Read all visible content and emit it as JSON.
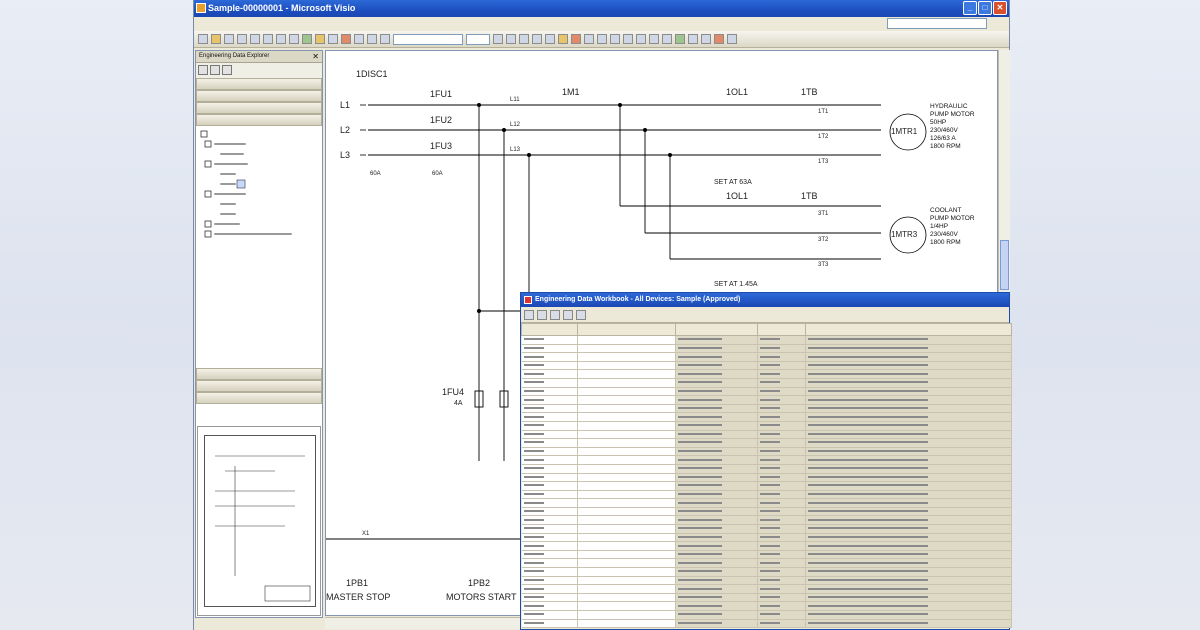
{
  "titlebar": {
    "title": "Sample-00000001 - Microsoft Visio"
  },
  "menu": [],
  "explorer": {
    "title": "Engineering Data Explorer",
    "nav_top": [
      "",
      "",
      "",
      ""
    ],
    "nav_bottom": [
      "",
      "",
      ""
    ]
  },
  "schematic": {
    "disconnect": "1DISC1",
    "lines": [
      "L1",
      "L2",
      "L3"
    ],
    "fuse_labels": [
      "1FU1",
      "1FU2",
      "1FU3"
    ],
    "wires": [
      "L11",
      "L12",
      "L13"
    ],
    "contactor": "1M1",
    "overload_1": "1OL1",
    "overload_2": "1OL1",
    "tb_1": "1TB",
    "tb_2": "1TB",
    "motor_1": "1MTR1",
    "motor_2": "1MTR3",
    "terminals_1": [
      "1T1",
      "1T2",
      "1T3"
    ],
    "terminals_2": [
      "3T1",
      "3T2",
      "3T3"
    ],
    "setting_1": "SET AT 63A",
    "setting_2": "SET AT 1.45A",
    "disc_rating": "60A",
    "fuse_rating": "60A",
    "fu4": "1FU4",
    "fu4_rating": "4A",
    "motor_1_desc": [
      "HYDRAULIC",
      "PUMP MOTOR",
      "50HP",
      "230/460V",
      "126/63 A",
      "1800 RPM"
    ],
    "motor_2_desc": [
      "COOLANT",
      "PUMP MOTOR",
      "1/4HP",
      "230/460V",
      "1800 RPM"
    ],
    "pb1": "1PB1",
    "pb1_desc": "MASTER STOP",
    "pb2": "1PB2",
    "pb2_desc": "MOTORS START",
    "x1": "X1"
  },
  "dialog": {
    "title": "Engineering Data Workbook - All Devices: Sample (Approved)",
    "columns": [
      "",
      "",
      "",
      "",
      ""
    ],
    "rows": []
  }
}
